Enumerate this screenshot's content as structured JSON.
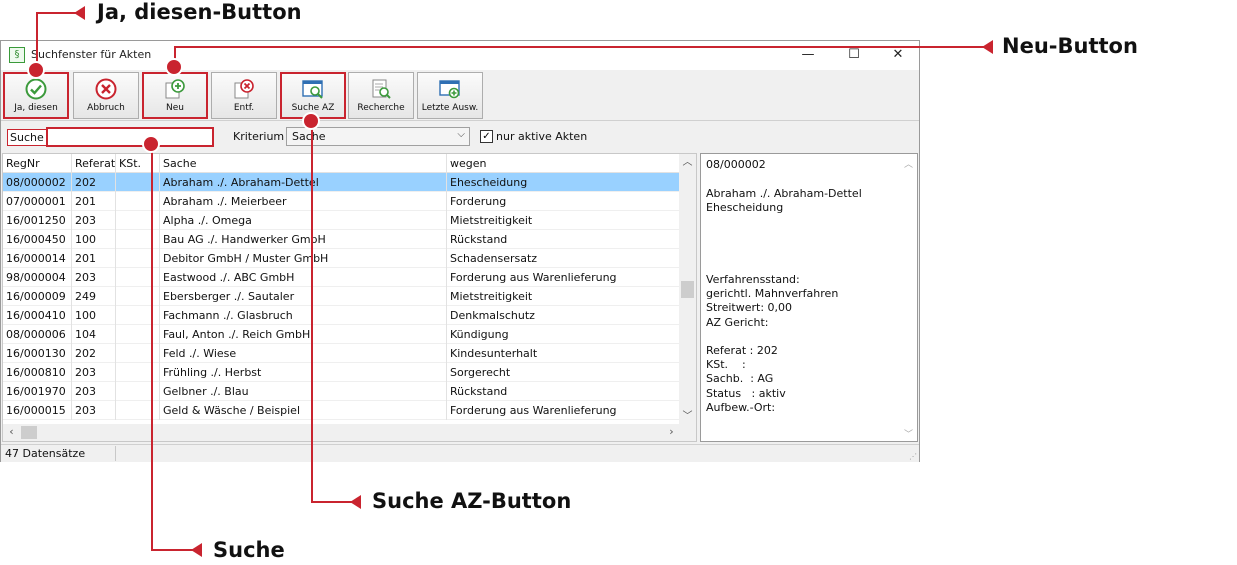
{
  "window": {
    "title": "Suchfenster für Akten",
    "app_icon": "§",
    "minimize": "—",
    "maximize": "☐",
    "close": "✕"
  },
  "toolbar": {
    "buttons": [
      {
        "label": "Ja, diesen",
        "icon": "check-icon",
        "color": "#3c9a3c"
      },
      {
        "label": "Abbruch",
        "icon": "cancel-icon",
        "color": "#c9242f"
      },
      {
        "label": "Neu",
        "icon": "new-document-icon",
        "color": "#3c9a3c"
      },
      {
        "label": "Entf.",
        "icon": "delete-document-icon",
        "color": "#c9242f"
      },
      {
        "label": "Suche AZ",
        "icon": "search-window-icon",
        "color": "#2f6fb3"
      },
      {
        "label": "Recherche",
        "icon": "research-document-icon",
        "color": "#3c9a3c"
      },
      {
        "label": "Letzte Ausw.",
        "icon": "last-selection-icon",
        "color": "#3c9a3c"
      }
    ]
  },
  "search": {
    "label": "Suche",
    "value": "",
    "criterion_label": "Kriterium",
    "criterion_value": "Sache",
    "active_only_label": "nur aktive Akten",
    "active_only_checked": true
  },
  "grid": {
    "columns": [
      "RegNr",
      "Referat",
      "KSt.",
      "Sache",
      "wegen"
    ],
    "rows": [
      [
        "08/000002",
        "202",
        "",
        "Abraham ./. Abraham-Dettel",
        "Ehescheidung"
      ],
      [
        "07/000001",
        "201",
        "",
        "Abraham ./. Meierbeer",
        "Forderung"
      ],
      [
        "16/001250",
        "203",
        "",
        "Alpha ./. Omega",
        "Mietstreitigkeit"
      ],
      [
        "16/000450",
        "100",
        "",
        "Bau AG ./. Handwerker GmbH",
        "Rückstand"
      ],
      [
        "16/000014",
        "201",
        "",
        "Debitor GmbH / Muster GmbH",
        "Schadensersatz"
      ],
      [
        "98/000004",
        "203",
        "",
        "Eastwood ./. ABC GmbH",
        "Forderung aus Warenlieferung"
      ],
      [
        "16/000009",
        "249",
        "",
        "Ebersberger ./. Sautaler",
        "Mietstreitigkeit"
      ],
      [
        "16/000410",
        "100",
        "",
        "Fachmann ./. Glasbruch",
        "Denkmalschutz"
      ],
      [
        "08/000006",
        "104",
        "",
        "Faul, Anton ./. Reich GmbH",
        "Kündigung"
      ],
      [
        "16/000130",
        "202",
        "",
        "Feld ./. Wiese",
        "Kindesunterhalt"
      ],
      [
        "16/000810",
        "203",
        "",
        "Frühling ./. Herbst",
        "Sorgerecht"
      ],
      [
        "16/001970",
        "203",
        "",
        "Gelbner ./. Blau",
        "Rückstand"
      ],
      [
        "16/000015",
        "203",
        "",
        "Geld & Wäsche / Beispiel",
        "Forderung aus Warenlieferung"
      ]
    ],
    "selected_index": 0
  },
  "detail": {
    "regnr": "08/000002",
    "sache": "Abraham ./. Abraham-Dettel",
    "wegen": "Ehescheidung",
    "verfahrensstand_label": "Verfahrensstand:",
    "verfahrensstand": "gerichtl. Mahnverfahren",
    "streitwert": "Streitwert: 0,00",
    "az_gericht": "AZ Gericht:",
    "referat": "Referat : 202",
    "kst": "KSt.    :",
    "sachb": "Sachb.  : AG",
    "status": "Status   : aktiv",
    "aufbew": "Aufbew.-Ort:"
  },
  "statusbar": {
    "count": "47 Datensätze"
  },
  "annotations": {
    "ja_diesen": "Ja, diesen-Button",
    "neu": "Neu-Button",
    "suche_az": "Suche AZ-Button",
    "suche": "Suche",
    "accent": "#c9242f"
  }
}
